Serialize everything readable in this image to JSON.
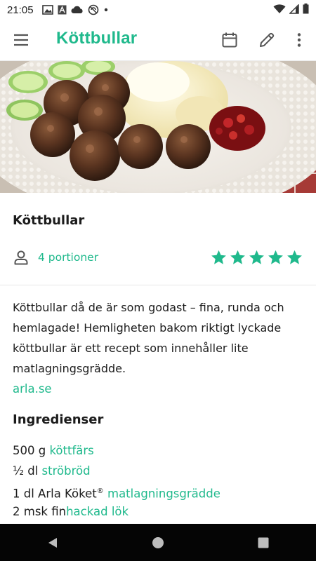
{
  "status": {
    "time": "21:05"
  },
  "header": {
    "title": "Köttbullar"
  },
  "recipe": {
    "title": "Köttbullar",
    "portions": "4 portioner",
    "rating": 5,
    "description": "Köttbullar då de är som godast – fina, runda och hemlagade! Hemligheten bakom riktigt lyckade köttbullar är ett recept som innehåller lite matlagningsgrädde.",
    "source": "arla.se"
  },
  "ingredients": {
    "title": "Ingredienser",
    "items": [
      {
        "prefix": "500 g ",
        "sup": "",
        "mid": "",
        "link": "köttfärs"
      },
      {
        "prefix": "½ dl ",
        "sup": "",
        "mid": "",
        "link": "ströbröd"
      },
      {
        "prefix": "1 dl Arla Köket",
        "sup": "®",
        "mid": " ",
        "link": "matlagningsgrädde"
      },
      {
        "prefix": "2 msk fin",
        "sup": "",
        "mid": "",
        "link": "hackad lök"
      }
    ]
  },
  "colors": {
    "accent": "#1fb98c",
    "navbar": "#050505"
  }
}
